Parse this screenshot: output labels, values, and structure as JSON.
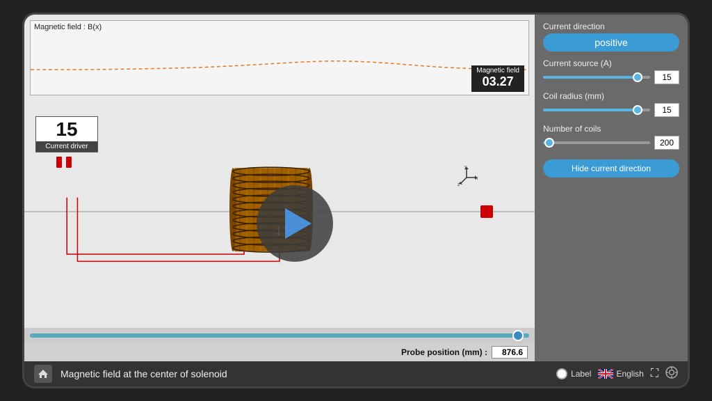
{
  "graph": {
    "title": "Magnetic field : B(x)",
    "badge_label": "Magnetic field",
    "badge_value": "03.27"
  },
  "current_driver": {
    "value": "15",
    "label": "Current driver"
  },
  "probe_position": {
    "label": "Probe position (mm) :",
    "value": "876.6"
  },
  "right_panel": {
    "current_direction_label": "Current direction",
    "positive_btn": "positive",
    "current_source_label": "Current source (A)",
    "current_source_value": "15",
    "coil_radius_label": "Coil radius (mm)",
    "coil_radius_value": "15",
    "num_coils_label": "Number of coils",
    "num_coils_value": "200",
    "hide_btn": "Hide current direction"
  },
  "bottom": {
    "title": "Magnetic field at the center of solenoid",
    "label_text": "Label",
    "lang_text": "English",
    "home_icon": "home-icon",
    "fullscreen_icon": "fullscreen-icon",
    "capture_icon": "camera-icon"
  }
}
